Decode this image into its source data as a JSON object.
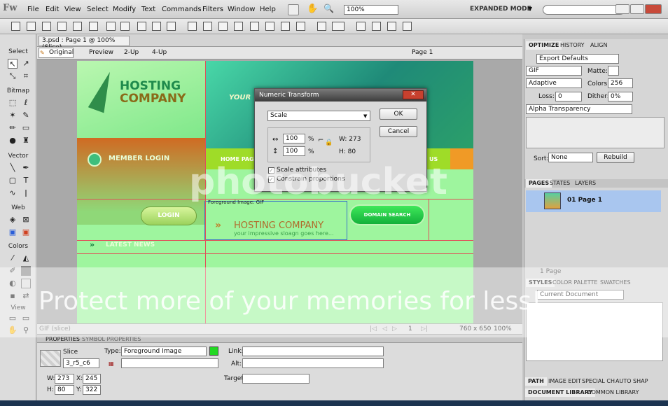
{
  "app": {
    "logo": "Fw",
    "mode": "EXPANDED MODE",
    "zoom": "100%"
  },
  "menu": [
    "File",
    "Edit",
    "View",
    "Select",
    "Modify",
    "Text",
    "Commands",
    "Filters",
    "Window",
    "Help"
  ],
  "tools": {
    "select": "Select",
    "bitmap": "Bitmap",
    "vector": "Vector",
    "web": "Web",
    "colors": "Colors",
    "view": "View"
  },
  "doc": {
    "tab": "3.psd : Page 1 @ 100% (Slice)",
    "views": [
      "Original",
      "Preview",
      "2-Up",
      "4-Up"
    ],
    "page": "Page 1"
  },
  "design": {
    "brand1": "HOSTING",
    "brand2": "COMPANY",
    "your": "YOUR",
    "member_login": "MEMBER LOGIN",
    "login": "LOGIN",
    "latest_news": "LATEST NEWS",
    "home_page": "HOME PAGE",
    "nav_us": "US",
    "domain_search": "DOMAIN SEARCH",
    "slice_label": "Foreground Image: GIF",
    "slogan": "your impressive sloagn goes here..."
  },
  "dialog": {
    "title": "Numeric Transform",
    "mode": "Scale",
    "ok": "OK",
    "cancel": "Cancel",
    "width_val": "100",
    "height_val": "100",
    "pct": "%",
    "w": "W: 273",
    "h": "H: 80",
    "scale_attr": "Scale attributes",
    "constrain": "Constrain proportions"
  },
  "status": {
    "page": "1",
    "size": "760 x 650",
    "zoom": "100%",
    "label": "GIF (slice)"
  },
  "properties": {
    "tab1": "PROPERTIES",
    "tab2": "SYMBOL PROPERTIES",
    "kind": "Slice",
    "name": "3_r5_c6",
    "type_label": "Type:",
    "type_val": "Foreground Image",
    "link_label": "Link:",
    "alt_label": "Alt:",
    "target_label": "Target:",
    "w_label": "W:",
    "w": "273",
    "x_label": "X:",
    "x": "245",
    "h_label": "H:",
    "h": "80",
    "y_label": "Y:",
    "y": "322"
  },
  "optimize": {
    "tabs": [
      "OPTIMIZE",
      "HISTORY",
      "ALIGN"
    ],
    "preset": "Export Defaults",
    "format": "GIF",
    "matte": "Matte:",
    "palette": "Adaptive",
    "colors_label": "Colors:",
    "colors": "256",
    "loss_label": "Loss:",
    "loss": "0",
    "dither_label": "Dither:",
    "dither": "0%",
    "transparency": "Alpha Transparency",
    "sort_label": "Sort:",
    "sort": "None",
    "rebuild": "Rebuild"
  },
  "pages": {
    "tabs": [
      "PAGES",
      "STATES",
      "LAYERS"
    ],
    "item": "01  Page 1",
    "count": "1 Page"
  },
  "styles": {
    "tabs": [
      "STYLES",
      "COLOR PALETTE",
      "SWATCHES"
    ],
    "current": "Current Document"
  },
  "bottom_tabs": [
    "PATH",
    "IMAGE EDIT",
    "SPECIAL CH",
    "AUTO SHAP"
  ],
  "library_tabs": [
    "DOCUMENT LIBRARY",
    "COMMON LIBRARY"
  ],
  "watermark": {
    "top": "photobucket",
    "bottom": "Protect more of your memories for less!"
  }
}
